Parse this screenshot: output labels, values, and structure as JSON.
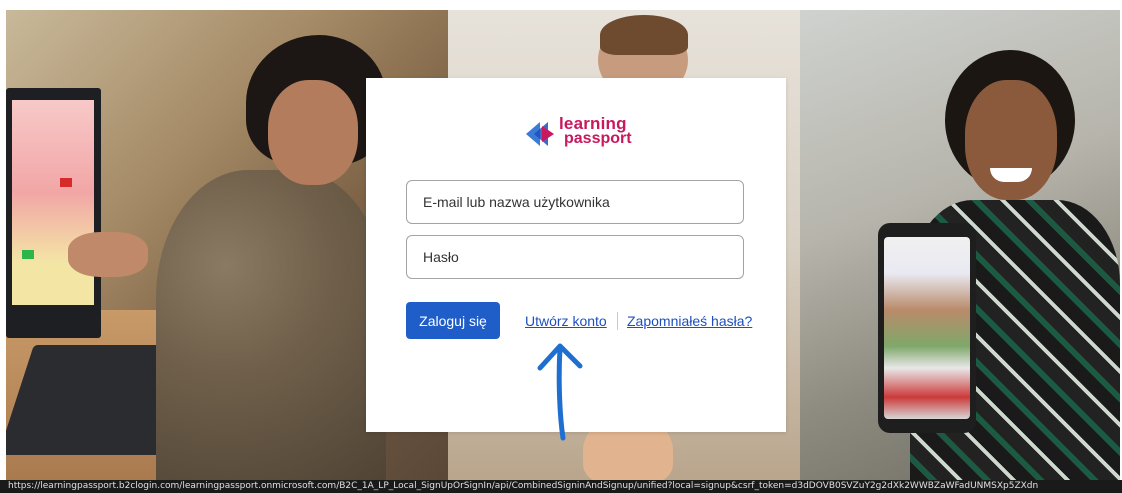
{
  "login": {
    "logo_line1": "learning",
    "logo_line2": "passport",
    "username_placeholder": "E-mail lub nazwa użytkownika",
    "password_placeholder": "Hasło",
    "signin_label": "Zaloguj się",
    "create_account_label": "Utwórz konto",
    "forgot_password_label": "Zapomniałeś hasła?"
  },
  "statusbar": {
    "url": "https://learningpassport.b2clogin.com/learningpassport.onmicrosoft.com/B2C_1A_LP_Local_SignUpOrSignIn/api/CombinedSigninAndSignup/unified?local=signup&csrf_token=d3dDOVB0SVZuY2g2dXk2WWBZaWFadUNMSXp5ZXdn"
  },
  "colors": {
    "accent_blue": "#1f5ec9",
    "link_blue": "#1d4fc0",
    "brand_pink": "#c8185e",
    "annotation_arrow": "#1f6fd1"
  },
  "icons": [
    "learning-passport-logo-icon",
    "annotation-arrow-icon"
  ]
}
